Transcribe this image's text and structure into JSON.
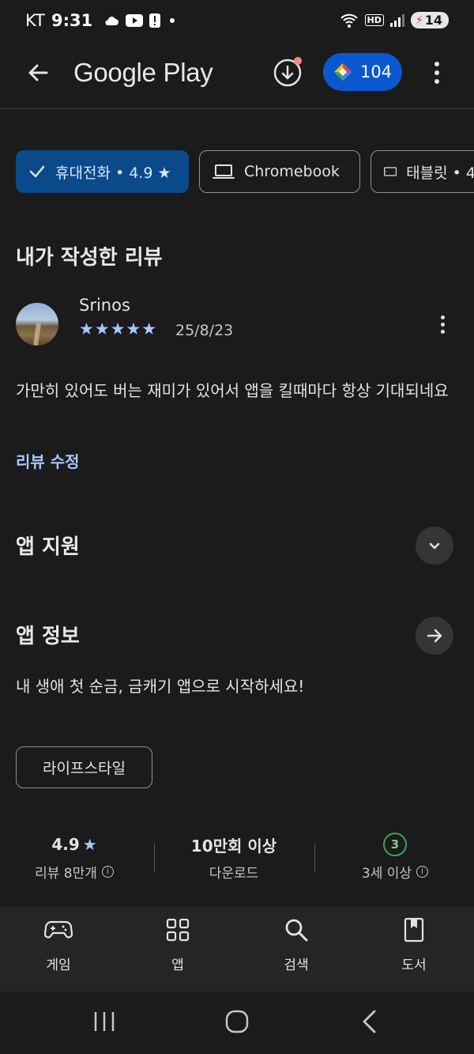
{
  "status_bar": {
    "carrier": "KT",
    "time": "9:31",
    "battery": "14",
    "hd_label": "HD"
  },
  "app_bar": {
    "title": "Google Play",
    "points": "104"
  },
  "device_chips": [
    {
      "label": "휴대전화 • 4.9 ★",
      "selected": true
    },
    {
      "label": "Chromebook",
      "selected": false
    },
    {
      "label": "태블릿 • 4",
      "selected": false
    }
  ],
  "my_review": {
    "section_title": "내가 작성한 리뷰",
    "reviewer_name": "Srinos",
    "rating_stars": "★★★★★",
    "rating": 5,
    "date": "25/8/23",
    "text": "가만히 있어도 버는 재미가 있어서 앱을 킬때마다 항상 기대되네요",
    "edit_label": "리뷰 수정"
  },
  "app_support": {
    "title": "앱 지원"
  },
  "app_info": {
    "title": "앱 정보",
    "description": "내 생애 첫 순금, 금캐기 앱으로 시작하세요!",
    "category": "라이프스타일"
  },
  "stats": {
    "rating_value": "4.9",
    "rating_star": "★",
    "rating_label": "리뷰 8만개",
    "downloads_value": "10만회 이상",
    "downloads_label": "다운로드",
    "age_badge": "3",
    "age_label": "3세 이상",
    "info_glyph": "i"
  },
  "bottom_nav": {
    "games": "게임",
    "apps": "앱",
    "search": "검색",
    "books": "도서"
  },
  "colors": {
    "background": "#1b1b1c",
    "accent_blue": "#0b57d0",
    "selected_chip": "#0b4a8a",
    "link_blue": "#a8c7fa",
    "age_green": "#34a853"
  }
}
